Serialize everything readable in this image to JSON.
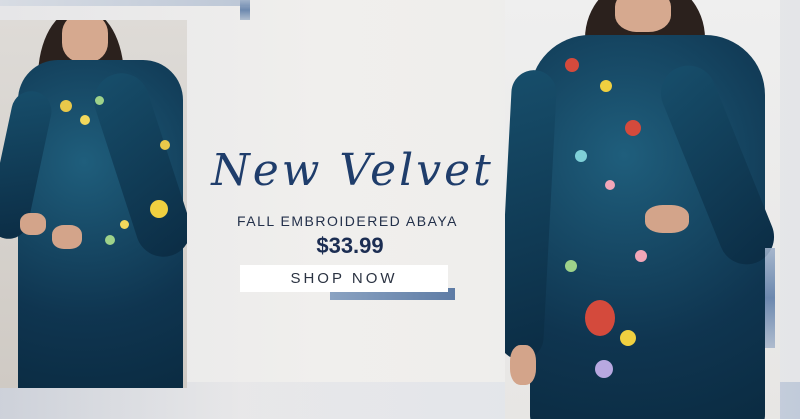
{
  "banner": {
    "headline": "New Velvet",
    "subtitle": "FALL EMBROIDERED ABAYA",
    "price": "$33.99",
    "cta_label": "SHOP NOW"
  },
  "colors": {
    "velvet": "#0f3550",
    "headline": "#1f3d6b",
    "background": "#ecebe9",
    "button": "#ffffff"
  }
}
